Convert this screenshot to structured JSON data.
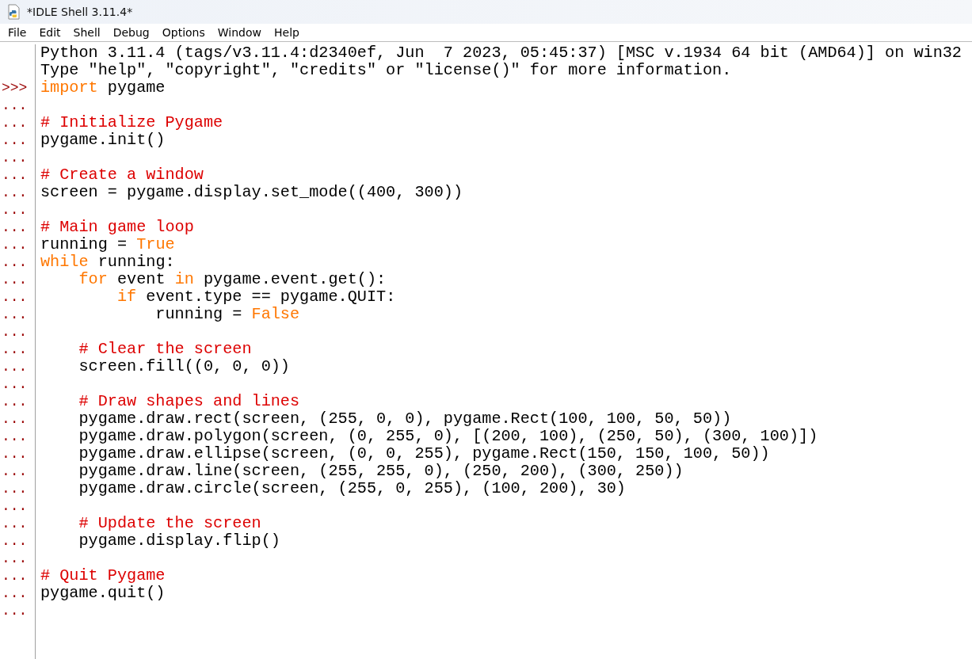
{
  "window": {
    "title": "*IDLE Shell 3.11.4*"
  },
  "menu": [
    "File",
    "Edit",
    "Shell",
    "Debug",
    "Options",
    "Window",
    "Help"
  ],
  "lines": [
    {
      "tokens": [
        {
          "kind": "plain",
          "text": "Python 3.11.4 (tags/v3.11.4:d2340ef, Jun  7 2023, 05:45:37) [MSC v.1934 64 bit (AMD64)] on win32"
        }
      ]
    },
    {
      "tokens": [
        {
          "kind": "plain",
          "text": "Type \"help\", \"copyright\", \"credits\" or \"license()\" for more information."
        }
      ]
    },
    {
      "prompt": ">>>",
      "tokens": [
        {
          "kind": "keyword",
          "text": "import"
        },
        {
          "kind": "plain",
          "text": " pygame"
        }
      ]
    },
    {
      "prompt": "..."
    },
    {
      "prompt": "...",
      "tokens": [
        {
          "kind": "comment",
          "text": "# Initialize Pygame"
        }
      ]
    },
    {
      "prompt": "...",
      "tokens": [
        {
          "kind": "plain",
          "text": "pygame.init()"
        }
      ]
    },
    {
      "prompt": "..."
    },
    {
      "prompt": "...",
      "tokens": [
        {
          "kind": "comment",
          "text": "# Create a window"
        }
      ]
    },
    {
      "prompt": "...",
      "tokens": [
        {
          "kind": "plain",
          "text": "screen = pygame.display.set_mode((400, 300))"
        }
      ]
    },
    {
      "prompt": "..."
    },
    {
      "prompt": "...",
      "tokens": [
        {
          "kind": "comment",
          "text": "# Main game loop"
        }
      ]
    },
    {
      "prompt": "...",
      "tokens": [
        {
          "kind": "plain",
          "text": "running = "
        },
        {
          "kind": "keyword",
          "text": "True"
        }
      ]
    },
    {
      "prompt": "...",
      "tokens": [
        {
          "kind": "keyword",
          "text": "while"
        },
        {
          "kind": "plain",
          "text": " running:"
        }
      ]
    },
    {
      "prompt": "...",
      "tokens": [
        {
          "kind": "keyword",
          "text": "    for"
        },
        {
          "kind": "plain",
          "text": " event "
        },
        {
          "kind": "keyword",
          "text": "in"
        },
        {
          "kind": "plain",
          "text": " pygame.event.get():"
        }
      ]
    },
    {
      "prompt": "...",
      "tokens": [
        {
          "kind": "keyword",
          "text": "        if"
        },
        {
          "kind": "plain",
          "text": " event.type == pygame.QUIT:"
        }
      ]
    },
    {
      "prompt": "...",
      "tokens": [
        {
          "kind": "plain",
          "text": "            running = "
        },
        {
          "kind": "keyword",
          "text": "False"
        }
      ]
    },
    {
      "prompt": "..."
    },
    {
      "prompt": "...",
      "tokens": [
        {
          "kind": "comment",
          "text": "    # Clear the screen"
        }
      ]
    },
    {
      "prompt": "...",
      "tokens": [
        {
          "kind": "plain",
          "text": "    screen.fill((0, 0, 0))"
        }
      ]
    },
    {
      "prompt": "..."
    },
    {
      "prompt": "...",
      "tokens": [
        {
          "kind": "comment",
          "text": "    # Draw shapes and lines"
        }
      ]
    },
    {
      "prompt": "...",
      "tokens": [
        {
          "kind": "plain",
          "text": "    pygame.draw.rect(screen, (255, 0, 0), pygame.Rect(100, 100, 50, 50))"
        }
      ]
    },
    {
      "prompt": "...",
      "tokens": [
        {
          "kind": "plain",
          "text": "    pygame.draw.polygon(screen, (0, 255, 0), [(200, 100), (250, 50), (300, 100)])"
        }
      ]
    },
    {
      "prompt": "...",
      "tokens": [
        {
          "kind": "plain",
          "text": "    pygame.draw.ellipse(screen, (0, 0, 255), pygame.Rect(150, 150, 100, 50))"
        }
      ]
    },
    {
      "prompt": "...",
      "tokens": [
        {
          "kind": "plain",
          "text": "    pygame.draw.line(screen, (255, 255, 0), (250, 200), (300, 250))"
        }
      ]
    },
    {
      "prompt": "...",
      "tokens": [
        {
          "kind": "plain",
          "text": "    pygame.draw.circle(screen, (255, 0, 255), (100, 200), 30)"
        }
      ]
    },
    {
      "prompt": "..."
    },
    {
      "prompt": "...",
      "tokens": [
        {
          "kind": "comment",
          "text": "    # Update the screen"
        }
      ]
    },
    {
      "prompt": "...",
      "tokens": [
        {
          "kind": "plain",
          "text": "    pygame.display.flip()"
        }
      ]
    },
    {
      "prompt": "..."
    },
    {
      "prompt": "...",
      "tokens": [
        {
          "kind": "comment",
          "text": "# Quit Pygame"
        }
      ]
    },
    {
      "prompt": "...",
      "tokens": [
        {
          "kind": "plain",
          "text": "pygame.quit()"
        }
      ]
    },
    {
      "prompt": "..."
    }
  ]
}
